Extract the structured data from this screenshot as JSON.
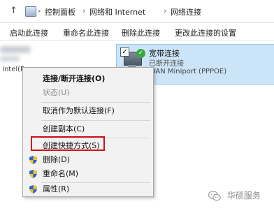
{
  "address_bar": {
    "up_glyph": "↑",
    "breadcrumbs": [
      "控制面板",
      "网络和 Internet",
      "网络连接"
    ],
    "separator": "›"
  },
  "command_bar": {
    "start_connection": "启动此连接",
    "rename_connection": "重命名此连接",
    "delete_connection": "删除此连接",
    "change_settings": "更改此连接的设置"
  },
  "connections": {
    "left_adapter_label": "Intel(R",
    "selected": {
      "name": "宽带连接",
      "status": "已断开连接",
      "device": "WAN Miniport (PPPOE)",
      "icon": "network-adapter-icon"
    }
  },
  "context_menu": {
    "items": [
      {
        "label": "连接/断开连接(O)",
        "bold": true,
        "disabled": false,
        "shield": false
      },
      {
        "label": "状态(U)",
        "bold": false,
        "disabled": true,
        "shield": false
      },
      {
        "label": "取消作为默认连接(F)",
        "bold": false,
        "disabled": false,
        "shield": false
      },
      {
        "label": "创建副本(C)",
        "bold": false,
        "disabled": false,
        "shield": false
      },
      {
        "label": "创建快捷方式(S)",
        "bold": false,
        "disabled": false,
        "shield": false,
        "highlighted": true
      },
      {
        "label": "删除(D)",
        "bold": false,
        "disabled": false,
        "shield": true
      },
      {
        "label": "重命名(M)",
        "bold": false,
        "disabled": false,
        "shield": true
      },
      {
        "label": "属性(R)",
        "bold": false,
        "disabled": false,
        "shield": true
      }
    ],
    "highlight_color": "#d0101a"
  },
  "watermark": {
    "text": "华硕服务",
    "icon": "wechat-icon"
  },
  "colors": {
    "selection": "#cce4f7",
    "menu_bg": "#f2f2f2"
  }
}
